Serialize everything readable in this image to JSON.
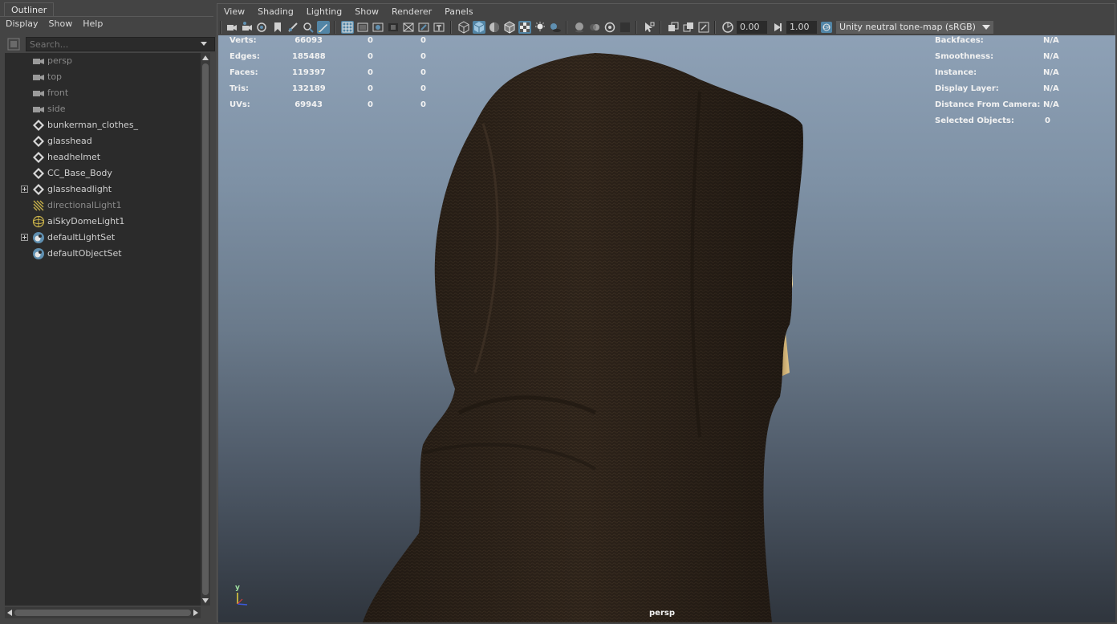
{
  "outliner": {
    "tab_label": "Outliner",
    "menu": [
      "Display",
      "Show",
      "Help"
    ],
    "search_placeholder": "Search...",
    "items": [
      {
        "label": "persp",
        "icon": "camera-icon",
        "dim": true,
        "expandable": false
      },
      {
        "label": "top",
        "icon": "camera-icon",
        "dim": true,
        "expandable": false
      },
      {
        "label": "front",
        "icon": "camera-icon",
        "dim": true,
        "expandable": false
      },
      {
        "label": "side",
        "icon": "camera-icon",
        "dim": true,
        "expandable": false
      },
      {
        "label": "bunkerman_clothes_",
        "icon": "transform-icon",
        "dim": false,
        "expandable": false
      },
      {
        "label": "glasshead",
        "icon": "transform-icon",
        "dim": false,
        "expandable": false
      },
      {
        "label": "headhelmet",
        "icon": "transform-icon",
        "dim": false,
        "expandable": false
      },
      {
        "label": "CC_Base_Body",
        "icon": "transform-icon",
        "dim": false,
        "expandable": false
      },
      {
        "label": "glassheadlight",
        "icon": "transform-icon",
        "dim": false,
        "expandable": true
      },
      {
        "label": "directionalLight1",
        "icon": "directional-light-icon",
        "dim": true,
        "expandable": false
      },
      {
        "label": "aiSkyDomeLight1",
        "icon": "sky-dome-light-icon",
        "dim": false,
        "expandable": false
      },
      {
        "label": "defaultLightSet",
        "icon": "set-icon",
        "dim": false,
        "expandable": true
      },
      {
        "label": "defaultObjectSet",
        "icon": "set-icon",
        "dim": false,
        "expandable": false
      }
    ]
  },
  "viewport": {
    "menu": [
      "View",
      "Shading",
      "Lighting",
      "Show",
      "Renderer",
      "Panels"
    ],
    "exposure_value": "0.00",
    "gamma_value": "1.00",
    "tonemap_label": "Unity neutral tone-map (sRGB)",
    "camera_label": "persp",
    "stats": [
      {
        "label": "Verts:",
        "value": "66093",
        "sel": "0",
        "comp": "0"
      },
      {
        "label": "Edges:",
        "value": "185488",
        "sel": "0",
        "comp": "0"
      },
      {
        "label": "Faces:",
        "value": "119397",
        "sel": "0",
        "comp": "0"
      },
      {
        "label": "Tris:",
        "value": "132189",
        "sel": "0",
        "comp": "0"
      },
      {
        "label": "UVs:",
        "value": "69943",
        "sel": "0",
        "comp": "0"
      }
    ],
    "info": [
      {
        "label": "Backfaces:",
        "value": "N/A"
      },
      {
        "label": "Smoothness:",
        "value": "N/A"
      },
      {
        "label": "Instance:",
        "value": "N/A"
      },
      {
        "label": "Display Layer:",
        "value": "N/A"
      },
      {
        "label": "Distance From Camera:",
        "value": "N/A"
      },
      {
        "label": "Selected Objects:",
        "value": "0"
      }
    ],
    "axis_label": "y"
  },
  "colors": {
    "panel_bg": "#444444",
    "field_bg": "#2b2b2b",
    "active_tool": "#5285a6",
    "viewport_top": "#8ea1b6",
    "viewport_bottom": "#2f353d"
  }
}
